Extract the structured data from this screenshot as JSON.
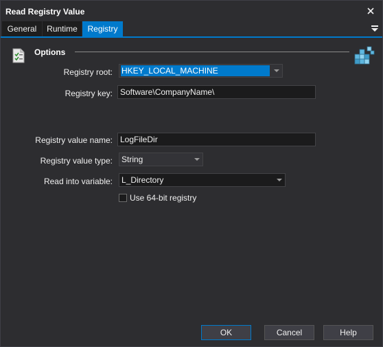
{
  "window": {
    "title": "Read Registry Value"
  },
  "tabs": [
    {
      "label": "General"
    },
    {
      "label": "Runtime"
    },
    {
      "label": "Registry"
    }
  ],
  "section": {
    "title": "Options"
  },
  "form": {
    "registry_root": {
      "label": "Registry root:",
      "value": "HKEY_LOCAL_MACHINE"
    },
    "registry_key": {
      "label": "Registry key:",
      "value": "Software\\CompanyName\\"
    },
    "value_name": {
      "label": "Registry value name:",
      "value": "LogFileDir"
    },
    "value_type": {
      "label": "Registry value type:",
      "value": "String"
    },
    "read_into": {
      "label": "Read into variable:",
      "value": "L_Directory"
    },
    "use_64bit": {
      "label": "Use 64-bit registry",
      "checked": false
    }
  },
  "buttons": {
    "ok": "OK",
    "cancel": "Cancel",
    "help": "Help"
  },
  "colors": {
    "background": "#2d2d30",
    "accent": "#007acc",
    "field": "#1b1b1c"
  }
}
